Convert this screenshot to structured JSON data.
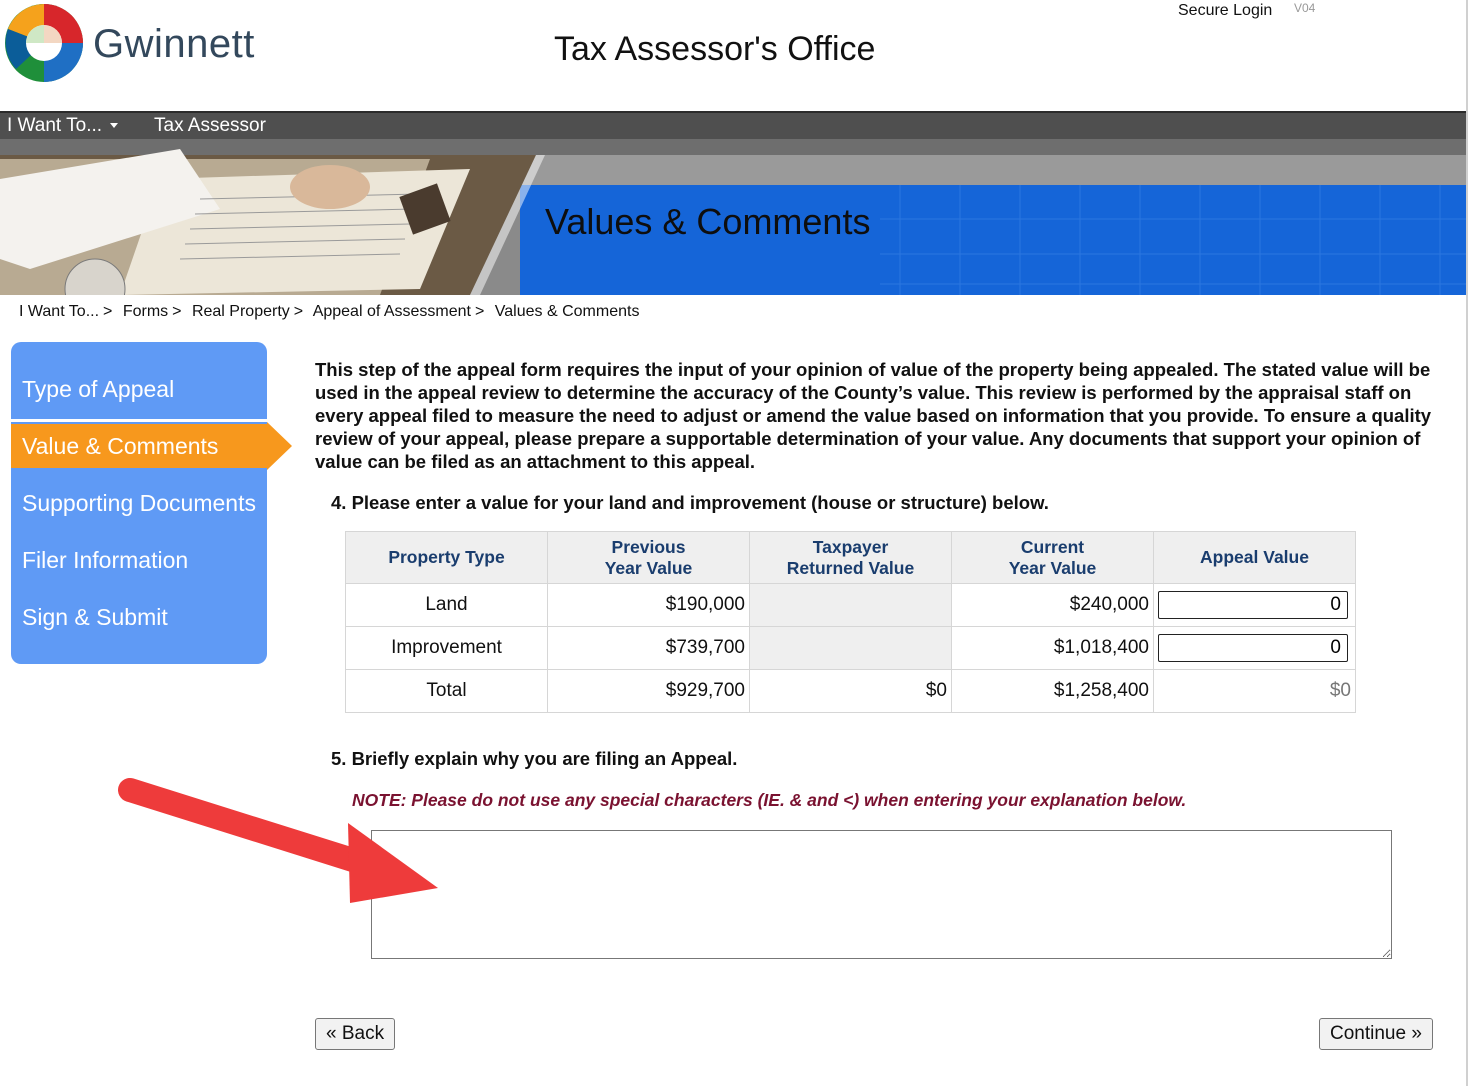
{
  "header": {
    "logo_text": "Gwinnett",
    "office_title": "Tax Assessor's Office",
    "secure_login": "Secure Login",
    "version": "V04"
  },
  "nav": {
    "i_want_to": "I Want To...",
    "tax_assessor": "Tax Assessor"
  },
  "banner": {
    "title": "Values & Comments"
  },
  "breadcrumb": [
    "I Want To...",
    "Forms",
    "Real Property",
    "Appeal of Assessment",
    "Values & Comments"
  ],
  "breadcrumb_separator": ">",
  "sidebar": {
    "items": [
      {
        "label": "Type of Appeal",
        "active": false
      },
      {
        "label": "Value & Comments",
        "active": true
      },
      {
        "label": "Supporting Documents",
        "active": false
      },
      {
        "label": "Filer Information",
        "active": false
      },
      {
        "label": "Sign & Submit",
        "active": false
      }
    ]
  },
  "main": {
    "intro": "This step of the appeal form requires the input of your opinion of value of the property being appealed. The stated value will be used in the appeal review to determine the accuracy of the County’s value. This review is performed by the appraisal staff on every appeal filed to measure the need to adjust or amend the value based on information that you provide. To ensure a quality review of your appeal, please prepare a supportable determination of your value.   Any documents that support your opinion of value can be filed as an attachment to this appeal.",
    "question4": "4. Please enter a value for your land and improvement (house or structure) below.",
    "table": {
      "headers": {
        "property_type": "Property Type",
        "previous_l1": "Previous",
        "previous_l2": "Year Value",
        "taxpayer_l1": "Taxpayer",
        "taxpayer_l2": "Returned Value",
        "current_l1": "Current",
        "current_l2": "Year Value",
        "appeal": "Appeal Value"
      },
      "rows": [
        {
          "type": "Land",
          "previous": "$190,000",
          "taxpayer": "",
          "current": "$240,000",
          "appeal": "0"
        },
        {
          "type": "Improvement",
          "previous": "$739,700",
          "taxpayer": "",
          "current": "$1,018,400",
          "appeal": "0"
        },
        {
          "type": "Total",
          "previous": "$929,700",
          "taxpayer": "$0",
          "current": "$1,258,400",
          "appeal": "$0"
        }
      ]
    },
    "question5": "5. Briefly explain why you are filing an Appeal.",
    "note": "NOTE: Please do not use any special characters (IE. & and <) when entering your explanation below.",
    "explanation_value": ""
  },
  "buttons": {
    "back": "« Back",
    "continue": "Continue »"
  },
  "colors": {
    "sidebar_bg": "#5f9af5",
    "sidebar_active": "#f7981d",
    "banner_blue": "#1565d8",
    "note_color": "#7a1230",
    "header_text_blue": "#1a3d6e",
    "annotation_arrow": "#ee3b3b"
  }
}
